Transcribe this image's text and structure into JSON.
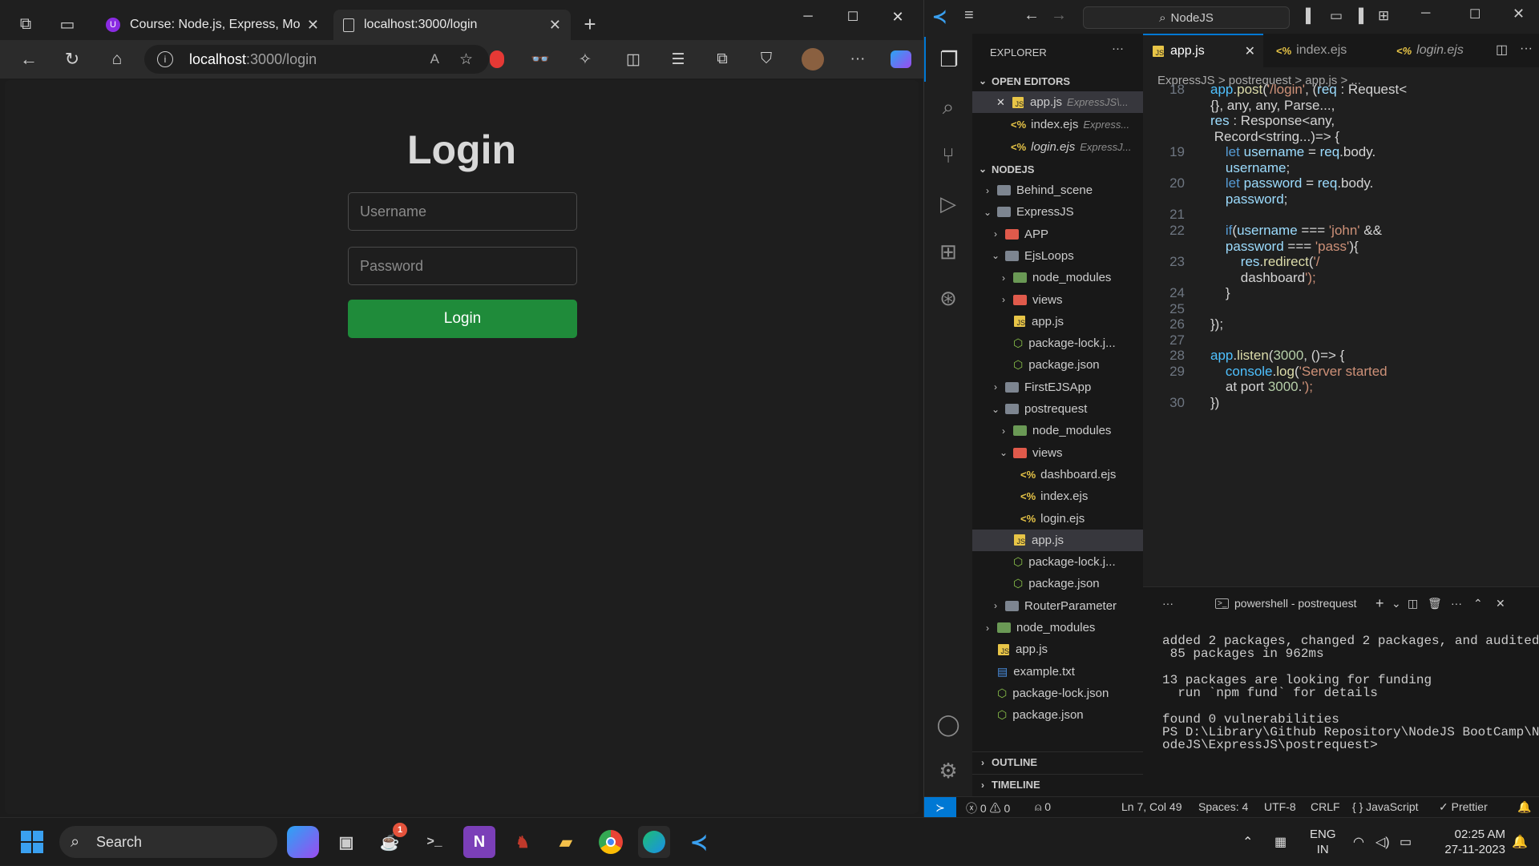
{
  "browser": {
    "tabs": [
      {
        "title": "Course: Node.js, Express, MongoDB",
        "icon": "udemy-icon"
      },
      {
        "title": "localhost:3000/login",
        "icon": "page-icon"
      }
    ],
    "address": {
      "host": "localhost",
      "path": ":3000/login"
    },
    "page": {
      "title": "Login",
      "username_placeholder": "Username",
      "password_placeholder": "Password",
      "button_label": "Login",
      "button_color": "#1f8b3a"
    }
  },
  "vscode": {
    "search_label": "NodeJS",
    "explorer_title": "EXPLORER",
    "open_editors_title": "OPEN EDITORS",
    "open_editors": [
      {
        "name": "app.js",
        "hint": "ExpressJS\\...",
        "type": "js"
      },
      {
        "name": "index.ejs",
        "hint": "Express...",
        "type": "ejs"
      },
      {
        "name": "login.ejs",
        "hint": "ExpressJ...",
        "type": "ejs"
      }
    ],
    "workspace_title": "NODEJS",
    "tree": [
      {
        "name": "Behind_scene",
        "type": "folder",
        "depth": 1,
        "open": false
      },
      {
        "name": "ExpressJS",
        "type": "folder",
        "depth": 1,
        "open": true
      },
      {
        "name": "APP",
        "type": "folder",
        "depth": 2,
        "open": false
      },
      {
        "name": "EjsLoops",
        "type": "folder",
        "depth": 2,
        "open": true
      },
      {
        "name": "node_modules",
        "type": "folder",
        "depth": 3,
        "open": false
      },
      {
        "name": "views",
        "type": "folder",
        "depth": 3,
        "open": false
      },
      {
        "name": "app.js",
        "type": "js",
        "depth": 3
      },
      {
        "name": "package-lock.j...",
        "type": "json",
        "depth": 3
      },
      {
        "name": "package.json",
        "type": "json",
        "depth": 3
      },
      {
        "name": "FirstEJSApp",
        "type": "folder",
        "depth": 2,
        "open": false
      },
      {
        "name": "postrequest",
        "type": "folder",
        "depth": 2,
        "open": true
      },
      {
        "name": "node_modules",
        "type": "folder",
        "depth": 3,
        "open": false
      },
      {
        "name": "views",
        "type": "folder",
        "depth": 3,
        "open": true
      },
      {
        "name": "dashboard.ejs",
        "type": "ejs",
        "depth": 4
      },
      {
        "name": "index.ejs",
        "type": "ejs",
        "depth": 4
      },
      {
        "name": "login.ejs",
        "type": "ejs",
        "depth": 4
      },
      {
        "name": "app.js",
        "type": "js",
        "depth": 3,
        "selected": true
      },
      {
        "name": "package-lock.j...",
        "type": "json",
        "depth": 3
      },
      {
        "name": "package.json",
        "type": "json",
        "depth": 3
      },
      {
        "name": "RouterParameter",
        "type": "folder",
        "depth": 2,
        "open": false
      },
      {
        "name": "node_modules",
        "type": "folder",
        "depth": 1,
        "open": false
      },
      {
        "name": "app.js",
        "type": "js",
        "depth": 1
      },
      {
        "name": "example.txt",
        "type": "txt",
        "depth": 1
      },
      {
        "name": "package-lock.json",
        "type": "json",
        "depth": 1
      },
      {
        "name": "package.json",
        "type": "json",
        "depth": 1
      }
    ],
    "outline_title": "OUTLINE",
    "timeline_title": "TIMELINE",
    "editor_tabs": [
      "app.js",
      "index.ejs",
      "login.ejs"
    ],
    "breadcrumb": "ExpressJS > postrequest > app.js > ...",
    "code": [
      {
        "ln": "18",
        "text": "app.post('/login', (req : Request<"
      },
      {
        "ln": "",
        "text": "{}, any, any, Parse...,"
      },
      {
        "ln": "",
        "text": "res : Response<any,"
      },
      {
        "ln": "",
        "text": " Record<string...)=> {"
      },
      {
        "ln": "19",
        "text": "    let username = req.body."
      },
      {
        "ln": "",
        "text": "    username;"
      },
      {
        "ln": "20",
        "text": "    let password = req.body."
      },
      {
        "ln": "",
        "text": "    password;"
      },
      {
        "ln": "21",
        "text": ""
      },
      {
        "ln": "22",
        "text": "    if(username === 'john' &&"
      },
      {
        "ln": "",
        "text": "    password === 'pass'){"
      },
      {
        "ln": "23",
        "text": "        res.redirect('/"
      },
      {
        "ln": "",
        "text": "        dashboard');"
      },
      {
        "ln": "24",
        "text": "    }"
      },
      {
        "ln": "25",
        "text": ""
      },
      {
        "ln": "26",
        "text": "});"
      },
      {
        "ln": "27",
        "text": ""
      },
      {
        "ln": "28",
        "text": "app.listen(3000, ()=> {"
      },
      {
        "ln": "29",
        "text": "    console.log('Server started"
      },
      {
        "ln": "",
        "text": "    at port 3000.');"
      },
      {
        "ln": "30",
        "text": "})"
      }
    ],
    "terminal": {
      "title": "powershell - postrequest",
      "lines": [
        "added 2 packages, changed 2 packages, and audited",
        " 85 packages in 962ms",
        "",
        "13 packages are looking for funding",
        "  run `npm fund` for details",
        "",
        "found 0 vulnerabilities",
        "PS D:\\Library\\Github Repository\\NodeJS BootCamp\\N",
        "odeJS\\ExpressJS\\postrequest> "
      ]
    },
    "status": {
      "errors": "0",
      "warnings": "0",
      "ports": "0",
      "position": "Ln 7, Col 49",
      "spaces": "Spaces: 4",
      "encoding": "UTF-8",
      "eol": "CRLF",
      "language": "{ } JavaScript",
      "formatter": "✓ Prettier"
    }
  },
  "taskbar": {
    "search_label": "Search",
    "badge": "1",
    "lang_line1": "ENG",
    "lang_line2": "IN",
    "time": "02:25 AM",
    "date": "27-11-2023"
  }
}
